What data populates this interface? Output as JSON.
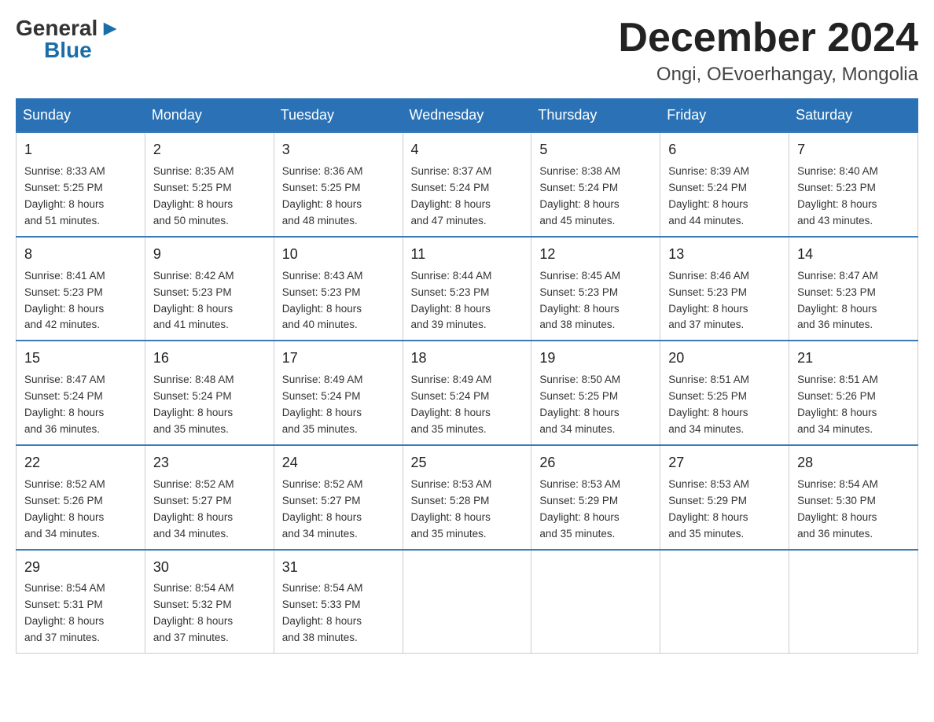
{
  "header": {
    "logo_general": "General",
    "logo_blue": "Blue",
    "month_title": "December 2024",
    "location": "Ongi, OEvoerhangay, Mongolia"
  },
  "days_of_week": [
    "Sunday",
    "Monday",
    "Tuesday",
    "Wednesday",
    "Thursday",
    "Friday",
    "Saturday"
  ],
  "weeks": [
    [
      {
        "day": "1",
        "sunrise": "8:33 AM",
        "sunset": "5:25 PM",
        "daylight": "8 hours and 51 minutes."
      },
      {
        "day": "2",
        "sunrise": "8:35 AM",
        "sunset": "5:25 PM",
        "daylight": "8 hours and 50 minutes."
      },
      {
        "day": "3",
        "sunrise": "8:36 AM",
        "sunset": "5:25 PM",
        "daylight": "8 hours and 48 minutes."
      },
      {
        "day": "4",
        "sunrise": "8:37 AM",
        "sunset": "5:24 PM",
        "daylight": "8 hours and 47 minutes."
      },
      {
        "day": "5",
        "sunrise": "8:38 AM",
        "sunset": "5:24 PM",
        "daylight": "8 hours and 45 minutes."
      },
      {
        "day": "6",
        "sunrise": "8:39 AM",
        "sunset": "5:24 PM",
        "daylight": "8 hours and 44 minutes."
      },
      {
        "day": "7",
        "sunrise": "8:40 AM",
        "sunset": "5:23 PM",
        "daylight": "8 hours and 43 minutes."
      }
    ],
    [
      {
        "day": "8",
        "sunrise": "8:41 AM",
        "sunset": "5:23 PM",
        "daylight": "8 hours and 42 minutes."
      },
      {
        "day": "9",
        "sunrise": "8:42 AM",
        "sunset": "5:23 PM",
        "daylight": "8 hours and 41 minutes."
      },
      {
        "day": "10",
        "sunrise": "8:43 AM",
        "sunset": "5:23 PM",
        "daylight": "8 hours and 40 minutes."
      },
      {
        "day": "11",
        "sunrise": "8:44 AM",
        "sunset": "5:23 PM",
        "daylight": "8 hours and 39 minutes."
      },
      {
        "day": "12",
        "sunrise": "8:45 AM",
        "sunset": "5:23 PM",
        "daylight": "8 hours and 38 minutes."
      },
      {
        "day": "13",
        "sunrise": "8:46 AM",
        "sunset": "5:23 PM",
        "daylight": "8 hours and 37 minutes."
      },
      {
        "day": "14",
        "sunrise": "8:47 AM",
        "sunset": "5:23 PM",
        "daylight": "8 hours and 36 minutes."
      }
    ],
    [
      {
        "day": "15",
        "sunrise": "8:47 AM",
        "sunset": "5:24 PM",
        "daylight": "8 hours and 36 minutes."
      },
      {
        "day": "16",
        "sunrise": "8:48 AM",
        "sunset": "5:24 PM",
        "daylight": "8 hours and 35 minutes."
      },
      {
        "day": "17",
        "sunrise": "8:49 AM",
        "sunset": "5:24 PM",
        "daylight": "8 hours and 35 minutes."
      },
      {
        "day": "18",
        "sunrise": "8:49 AM",
        "sunset": "5:24 PM",
        "daylight": "8 hours and 35 minutes."
      },
      {
        "day": "19",
        "sunrise": "8:50 AM",
        "sunset": "5:25 PM",
        "daylight": "8 hours and 34 minutes."
      },
      {
        "day": "20",
        "sunrise": "8:51 AM",
        "sunset": "5:25 PM",
        "daylight": "8 hours and 34 minutes."
      },
      {
        "day": "21",
        "sunrise": "8:51 AM",
        "sunset": "5:26 PM",
        "daylight": "8 hours and 34 minutes."
      }
    ],
    [
      {
        "day": "22",
        "sunrise": "8:52 AM",
        "sunset": "5:26 PM",
        "daylight": "8 hours and 34 minutes."
      },
      {
        "day": "23",
        "sunrise": "8:52 AM",
        "sunset": "5:27 PM",
        "daylight": "8 hours and 34 minutes."
      },
      {
        "day": "24",
        "sunrise": "8:52 AM",
        "sunset": "5:27 PM",
        "daylight": "8 hours and 34 minutes."
      },
      {
        "day": "25",
        "sunrise": "8:53 AM",
        "sunset": "5:28 PM",
        "daylight": "8 hours and 35 minutes."
      },
      {
        "day": "26",
        "sunrise": "8:53 AM",
        "sunset": "5:29 PM",
        "daylight": "8 hours and 35 minutes."
      },
      {
        "day": "27",
        "sunrise": "8:53 AM",
        "sunset": "5:29 PM",
        "daylight": "8 hours and 35 minutes."
      },
      {
        "day": "28",
        "sunrise": "8:54 AM",
        "sunset": "5:30 PM",
        "daylight": "8 hours and 36 minutes."
      }
    ],
    [
      {
        "day": "29",
        "sunrise": "8:54 AM",
        "sunset": "5:31 PM",
        "daylight": "8 hours and 37 minutes."
      },
      {
        "day": "30",
        "sunrise": "8:54 AM",
        "sunset": "5:32 PM",
        "daylight": "8 hours and 37 minutes."
      },
      {
        "day": "31",
        "sunrise": "8:54 AM",
        "sunset": "5:33 PM",
        "daylight": "8 hours and 38 minutes."
      },
      null,
      null,
      null,
      null
    ]
  ],
  "labels": {
    "sunrise": "Sunrise:",
    "sunset": "Sunset:",
    "daylight": "Daylight:"
  }
}
